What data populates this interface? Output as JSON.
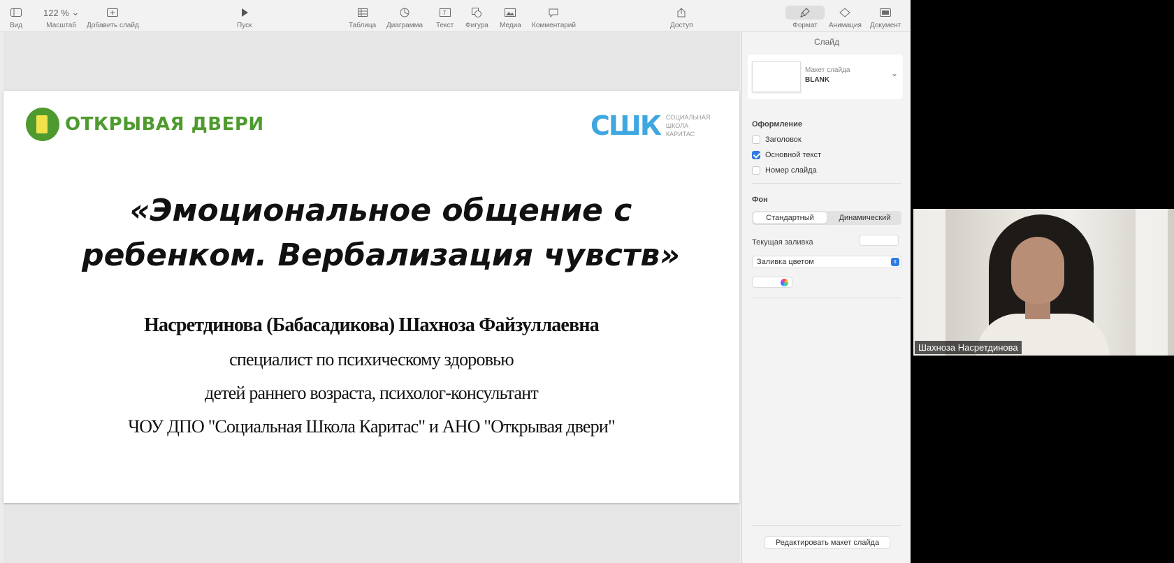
{
  "toolbar": {
    "view": "Вид",
    "zoom_value": "122 %",
    "zoom": "Масштаб",
    "add_slide": "Добавить слайд",
    "play": "Пуск",
    "table": "Таблица",
    "chart": "Диаграмма",
    "text": "Текст",
    "shape": "Фигура",
    "media": "Медиа",
    "comment": "Комментарий",
    "share": "Доступ",
    "format": "Формат",
    "animate": "Анимация",
    "document": "Документ"
  },
  "slide": {
    "logo_left_text": "ОТКРЫВАЯ ДВЕРИ",
    "logo_right_text": "СШК",
    "logo_right_sub_1": "СОЦИАЛЬНАЯ",
    "logo_right_sub_2": "ШКОЛА",
    "logo_right_sub_3": "КАРИТАС",
    "title_line1": "«Эмоциональное общение с",
    "title_line2": "ребенком. Вербализация чувств»",
    "author": "Насретдинова (Бабасадикова) Шахноза Файзуллаевна",
    "line1": "специалист по психическому здоровью",
    "line2": "детей раннего возраста, психолог-консультант",
    "line3": "ЧОУ ДПО \"Социальная Школа Каритас\" и АНО \"Открывая двери\""
  },
  "panel": {
    "title": "Слайд",
    "layout_label": "Макет слайда",
    "layout_value": "BLANK",
    "appearance_header": "Оформление",
    "cb_title": "Заголовок",
    "cb_title_checked": false,
    "cb_body": "Основной текст",
    "cb_body_checked": true,
    "cb_slide_number": "Номер слайда",
    "cb_slide_number_checked": false,
    "background_header": "Фон",
    "seg_standard": "Стандартный",
    "seg_dynamic": "Динамический",
    "current_fill": "Текущая заливка",
    "fill_select": "Заливка цветом",
    "edit_layout": "Редактировать макет слайда"
  },
  "video": {
    "participant_name": "Шахноза Насретдинова"
  },
  "colors": {
    "accent_blue": "#2f7ae5",
    "logo_green": "#4e9a2f",
    "logo_blue": "#3fa7e0"
  }
}
